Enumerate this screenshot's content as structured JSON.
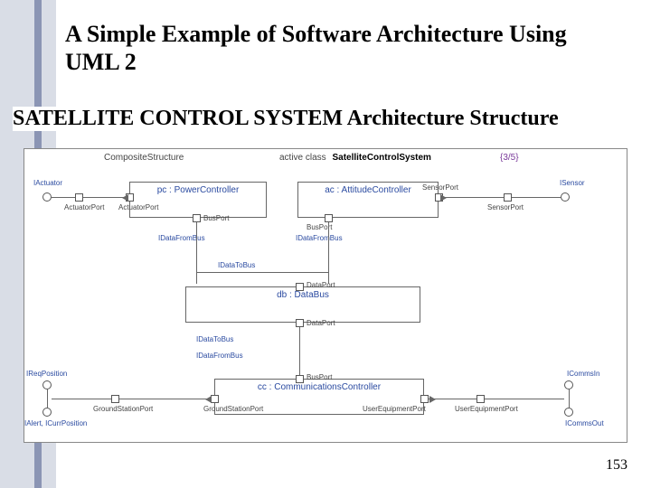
{
  "slide": {
    "title": "A Simple Example of Software Architecture Using UML 2",
    "subtitle": "SATELLITE CONTROL SYSTEM Architecture Structure",
    "page_number": "153"
  },
  "diagram": {
    "frame_kind": "CompositeStructure",
    "frame_kw": "active class",
    "frame_class": "SatelliteControlSystem",
    "frame_idx": "{3/5}",
    "components": {
      "pc": "pc : PowerController",
      "ac": "ac : AttitudeController",
      "db": "db : DataBus",
      "cc": "cc : CommunicationsController"
    },
    "ports": {
      "actuator_port": "ActuatorPort",
      "sensor_port": "SensorPort",
      "bus_port": "BusPort",
      "data_port": "DataPort",
      "ground_station_port": "GroundStationPort",
      "user_equipment_port": "UserEquipmentPort"
    },
    "interfaces": {
      "iactuator": "IActuator",
      "isensor": "ISensor",
      "idata_from_bus": "IDataFromBus",
      "idata_to_bus": "IDataToBus",
      "ireq_position": "IReqPosition",
      "ialert_icurr_position": "IAlert, ICurrPosition",
      "icomms_in": "ICommsIn",
      "icomms_out": "ICommsOut"
    }
  }
}
